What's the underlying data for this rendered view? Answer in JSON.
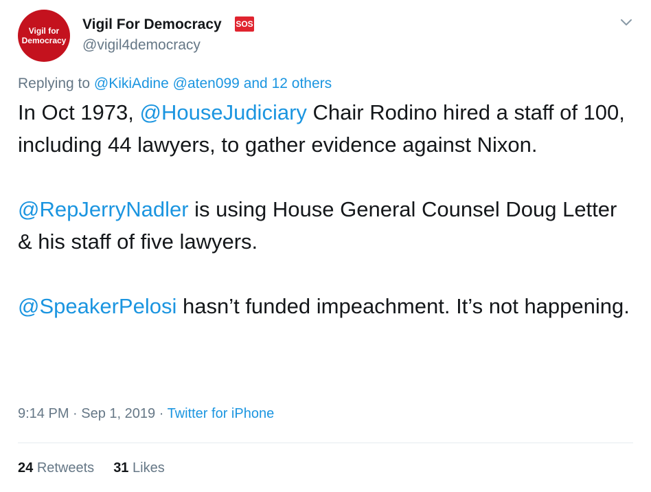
{
  "author": {
    "avatar_line1": "Vigil for",
    "avatar_line2": "Democracy",
    "display_name": "Vigil For Democracy",
    "badge": "SOS",
    "handle": "@vigil4democracy"
  },
  "reply": {
    "prefix": "Replying to",
    "mention1": "@KikiAdine",
    "mention2": "@aten099",
    "others": "and 12 others"
  },
  "body": {
    "p1_part1": "In Oct 1973, ",
    "p1_mention": "@HouseJudiciary",
    "p1_part2": " Chair Rodino hired a staff of 100, including 44 lawyers, to gather evidence against Nixon.",
    "p2_mention": "@RepJerryNadler",
    "p2_part": " is using House General Counsel Doug Letter & his staff of five lawyers.",
    "p3_mention": "@SpeakerPelosi",
    "p3_part": " hasn’t funded impeachment. It’s not happening."
  },
  "meta": {
    "time": "9:14 PM",
    "sep1": " · ",
    "date": "Sep 1, 2019",
    "sep2": " · ",
    "source": "Twitter for iPhone"
  },
  "stats": {
    "retweets_count": "24",
    "retweets_label": "Retweets",
    "likes_count": "31",
    "likes_label": "Likes"
  },
  "colors": {
    "link": "#1b95e0",
    "muted": "#657786",
    "text": "#14171a",
    "avatar_bg": "#c4121e",
    "badge_bg": "#e0242f"
  },
  "icons": {
    "menu": "chevron-down-icon"
  }
}
